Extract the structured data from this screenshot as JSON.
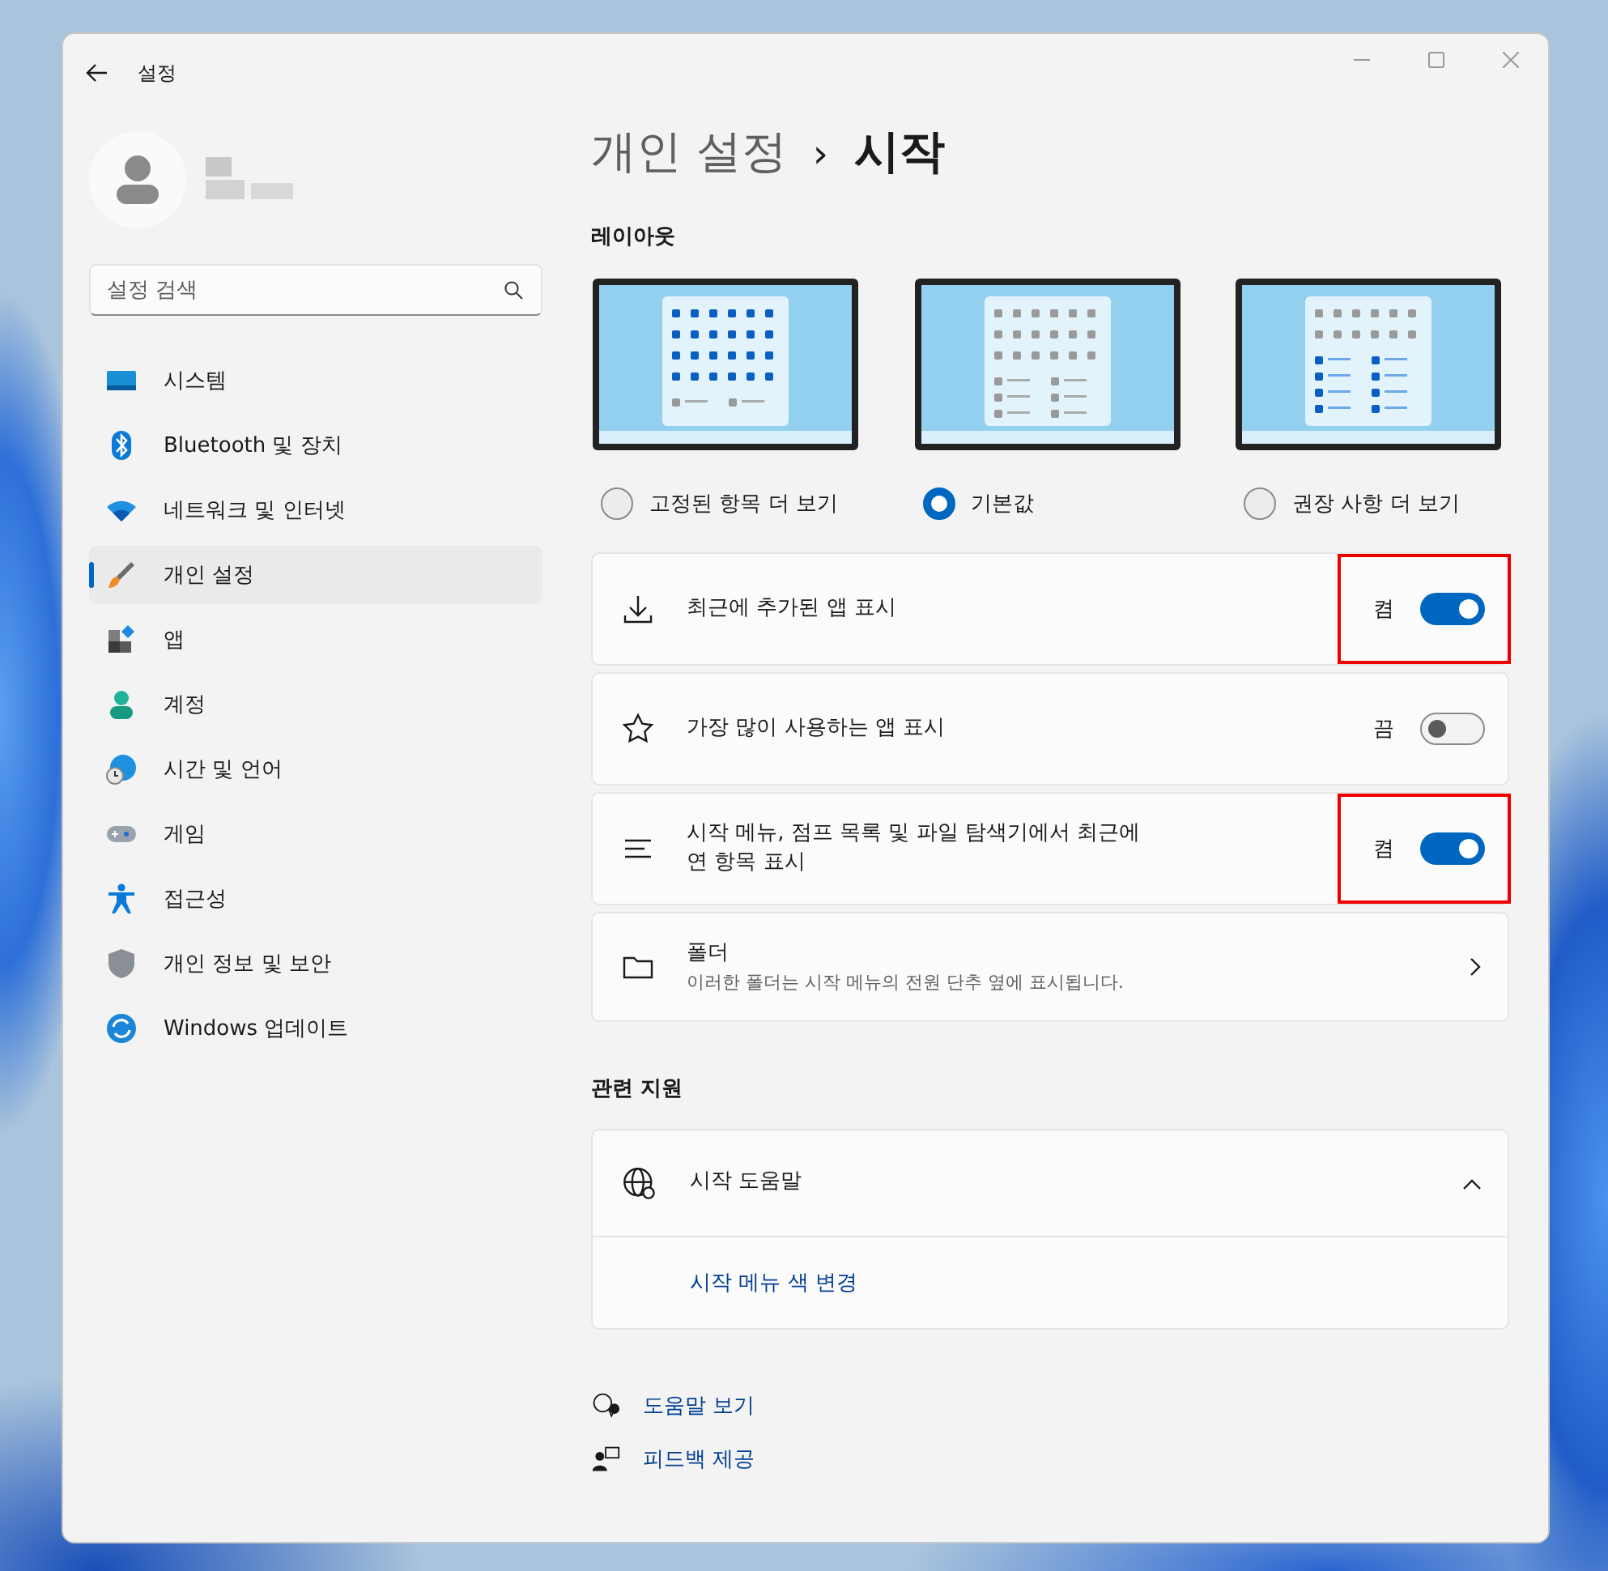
{
  "window": {
    "title": "설정"
  },
  "search": {
    "placeholder": "설정 검색"
  },
  "sidebar": {
    "items": [
      {
        "label": "시스템",
        "selected": false
      },
      {
        "label": "Bluetooth 및 장치",
        "selected": false
      },
      {
        "label": "네트워크 및 인터넷",
        "selected": false
      },
      {
        "label": "개인 설정",
        "selected": true
      },
      {
        "label": "앱",
        "selected": false
      },
      {
        "label": "계정",
        "selected": false
      },
      {
        "label": "시간 및 언어",
        "selected": false
      },
      {
        "label": "게임",
        "selected": false
      },
      {
        "label": "접근성",
        "selected": false
      },
      {
        "label": "개인 정보 및 보안",
        "selected": false
      },
      {
        "label": "Windows 업데이트",
        "selected": false
      }
    ]
  },
  "breadcrumb": {
    "parent": "개인 설정",
    "separator": "›",
    "current": "시작"
  },
  "layout": {
    "heading": "레이아웃",
    "options": [
      {
        "kind": "pins",
        "label": "고정된 항목 더 보기",
        "selected": false
      },
      {
        "kind": "default",
        "label": "기본값",
        "selected": true
      },
      {
        "kind": "recommendations",
        "label": "권장 사항 더 보기",
        "selected": false
      }
    ]
  },
  "settings": [
    {
      "kind": "toggle",
      "label": "최근에 추가된 앱 표시",
      "state_label": "켬",
      "on": true,
      "highlighted": true
    },
    {
      "kind": "toggle",
      "label": "가장 많이 사용하는 앱 표시",
      "state_label": "끔",
      "on": false,
      "highlighted": false
    },
    {
      "kind": "toggle",
      "label": "시작 메뉴, 점프 목록 및 파일 탐색기에서 최근에\n연 항목 표시",
      "state_label": "켬",
      "on": true,
      "highlighted": true
    },
    {
      "kind": "link",
      "label": "폴더",
      "description": "이러한 폴더는 시작 메뉴의 전원 단추 옆에 표시됩니다."
    }
  ],
  "related": {
    "heading": "관련 지원",
    "title": "시작 도움말",
    "expanded": true,
    "links": [
      "시작 메뉴 색 변경"
    ]
  },
  "footer_links": [
    "도움말 보기",
    "피드백 제공"
  ]
}
